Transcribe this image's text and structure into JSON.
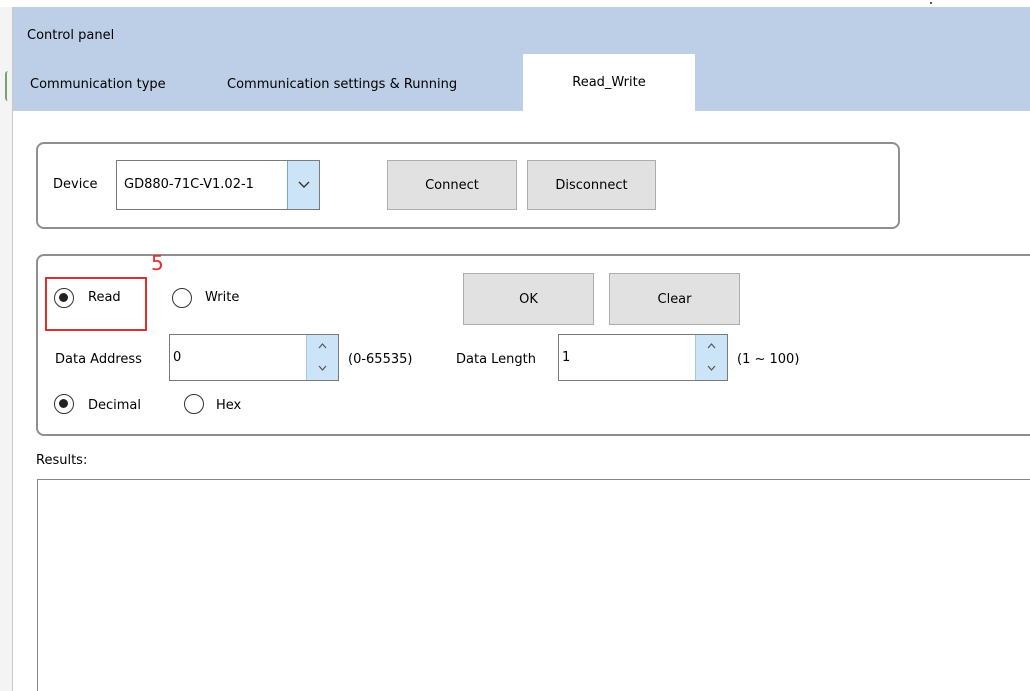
{
  "window": {
    "title": "Control panel"
  },
  "tabs": [
    {
      "label": "Communication type"
    },
    {
      "label": "Communication settings & Running"
    },
    {
      "label": "Read_Write",
      "active": true
    }
  ],
  "device": {
    "label": "Device",
    "selected": "GD880-71C-V1.02-1",
    "connect_label": "Connect",
    "disconnect_label": "Disconnect"
  },
  "readwrite": {
    "read_label": "Read",
    "write_label": "Write",
    "selected_mode": "Read",
    "ok_label": "OK",
    "clear_label": "Clear",
    "data_address_label": "Data Address",
    "data_address_value": "0",
    "data_address_range": "(0-65535)",
    "data_length_label": "Data Length",
    "data_length_value": "1",
    "data_length_range": "(1 ~ 100)",
    "decimal_label": "Decimal",
    "hex_label": "Hex",
    "selected_format": "Decimal"
  },
  "annotation": {
    "number": "5",
    "color": "#e03030"
  },
  "results": {
    "label": "Results:",
    "content": ""
  },
  "colors": {
    "header_bg": "#bccfe6",
    "spin_btn_bg": "#cce4f7",
    "button_bg": "#e1e1e1"
  },
  "icons": {
    "combo_arrow": "chevron-down-icon",
    "spin_up": "chevron-up-icon",
    "spin_down": "chevron-down-icon"
  }
}
